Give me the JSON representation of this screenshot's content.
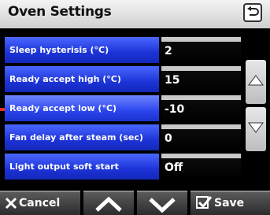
{
  "header": {
    "title": "Oven Settings"
  },
  "settings": [
    {
      "label": "Sleep hysterisis (°C)",
      "value": "2"
    },
    {
      "label": "Ready accept high (°C)",
      "value": "15"
    },
    {
      "label": "Ready accept low (°C)",
      "value": "-10"
    },
    {
      "label": "Fan delay after steam (sec)",
      "value": "0"
    },
    {
      "label": "Light output soft start",
      "value": "Off"
    }
  ],
  "footer": {
    "cancel_label": "Cancel",
    "save_label": "Save"
  },
  "colors": {
    "row_blue": "#1c33d8",
    "titlebar": "#e6e6e6",
    "background": "#000000"
  },
  "icons": [
    "back-arrow-icon",
    "scroll-up-icon",
    "scroll-down-icon",
    "close-x-icon",
    "chevron-up-icon",
    "chevron-down-icon",
    "checkbox-check-icon"
  ]
}
